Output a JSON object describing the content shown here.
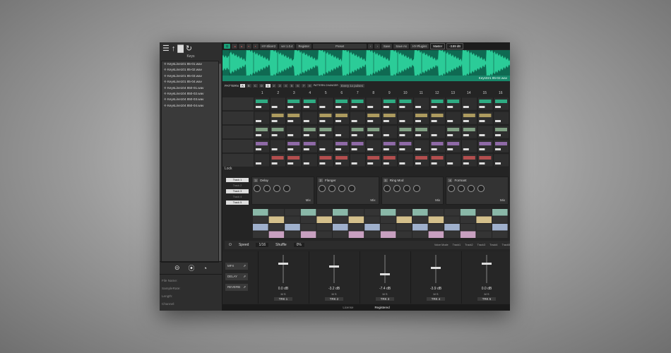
{
  "sidebar": {
    "title": "Keys",
    "files": [
      "KeysLine101 85-01.wav",
      "KeysLine101 85-02.wav",
      "KeysLine101 85-03.wav",
      "KeysLine101 85-04.wav",
      "KeysLine104 850-01.wav",
      "KeysLine104 850-02.wav",
      "KeysLine104 850-03.wav",
      "KeysLine104 850-04.wav"
    ],
    "meta": [
      "File Name:",
      "SampleRate:",
      "Length:",
      "Channel:"
    ]
  },
  "topbar": {
    "version": "ver 1.0.4",
    "brand": "HY-Slicer2",
    "register": "Register",
    "preset": "Preset",
    "save": "Save",
    "save_as": "Save As",
    "plugins": "HY-Plugins",
    "master": "Master",
    "master_db": "-3.89 dB"
  },
  "waveform": {
    "filename": "Keys021 85-02.wav"
  },
  "pattern": {
    "label": "PATTERN",
    "banks": [
      "A",
      "B",
      "C",
      "D"
    ],
    "numbers": [
      "1",
      "2",
      "3",
      "4",
      "5",
      "6",
      "7",
      "8"
    ],
    "changer": "PATTERN CHANGER",
    "mode": "Every 1x pulses"
  },
  "steps": [
    "1",
    "2",
    "3",
    "4",
    "5",
    "6",
    "7",
    "8",
    "9",
    "10",
    "11",
    "12",
    "13",
    "14",
    "15",
    "16"
  ],
  "lock_label": "Lock",
  "tracks": [
    "Track 1",
    "Track 2",
    "Track 3",
    "Track 4",
    "Track 5"
  ],
  "effects": [
    {
      "num": "1",
      "name": "Delay"
    },
    {
      "num": "2",
      "name": "Flanger"
    },
    {
      "num": "3",
      "name": "Ring Mod"
    },
    {
      "num": "4",
      "name": "Formant"
    }
  ],
  "mix_label": "Mix",
  "speed": {
    "label": "Speed",
    "value": "1/16",
    "shuffle_label": "Shuffle",
    "shuffle_value": "0%"
  },
  "voice_mode": [
    "Voice Mode",
    "Track1",
    "Track2",
    "Track3",
    "Track4",
    "Track5"
  ],
  "sends": [
    "MFX",
    "DELAY",
    "REVERB"
  ],
  "channels": [
    {
      "name": "TRK 1",
      "db": "0.0 dB",
      "level": 0.72
    },
    {
      "name": "TRK 2",
      "db": "-3.2 dB",
      "level": 0.62
    },
    {
      "name": "TRK 3",
      "db": "-7.4 dB",
      "level": 0.35
    },
    {
      "name": "TRK 4",
      "db": "-3.9 dB",
      "level": 0.58
    },
    {
      "name": "TRK 5",
      "db": "0.0 dB",
      "level": 0.72
    }
  ],
  "status": {
    "left": "License",
    "right": "Registered"
  },
  "colors": {
    "accent": "#1aa077",
    "wave": "#2fd7a0"
  }
}
